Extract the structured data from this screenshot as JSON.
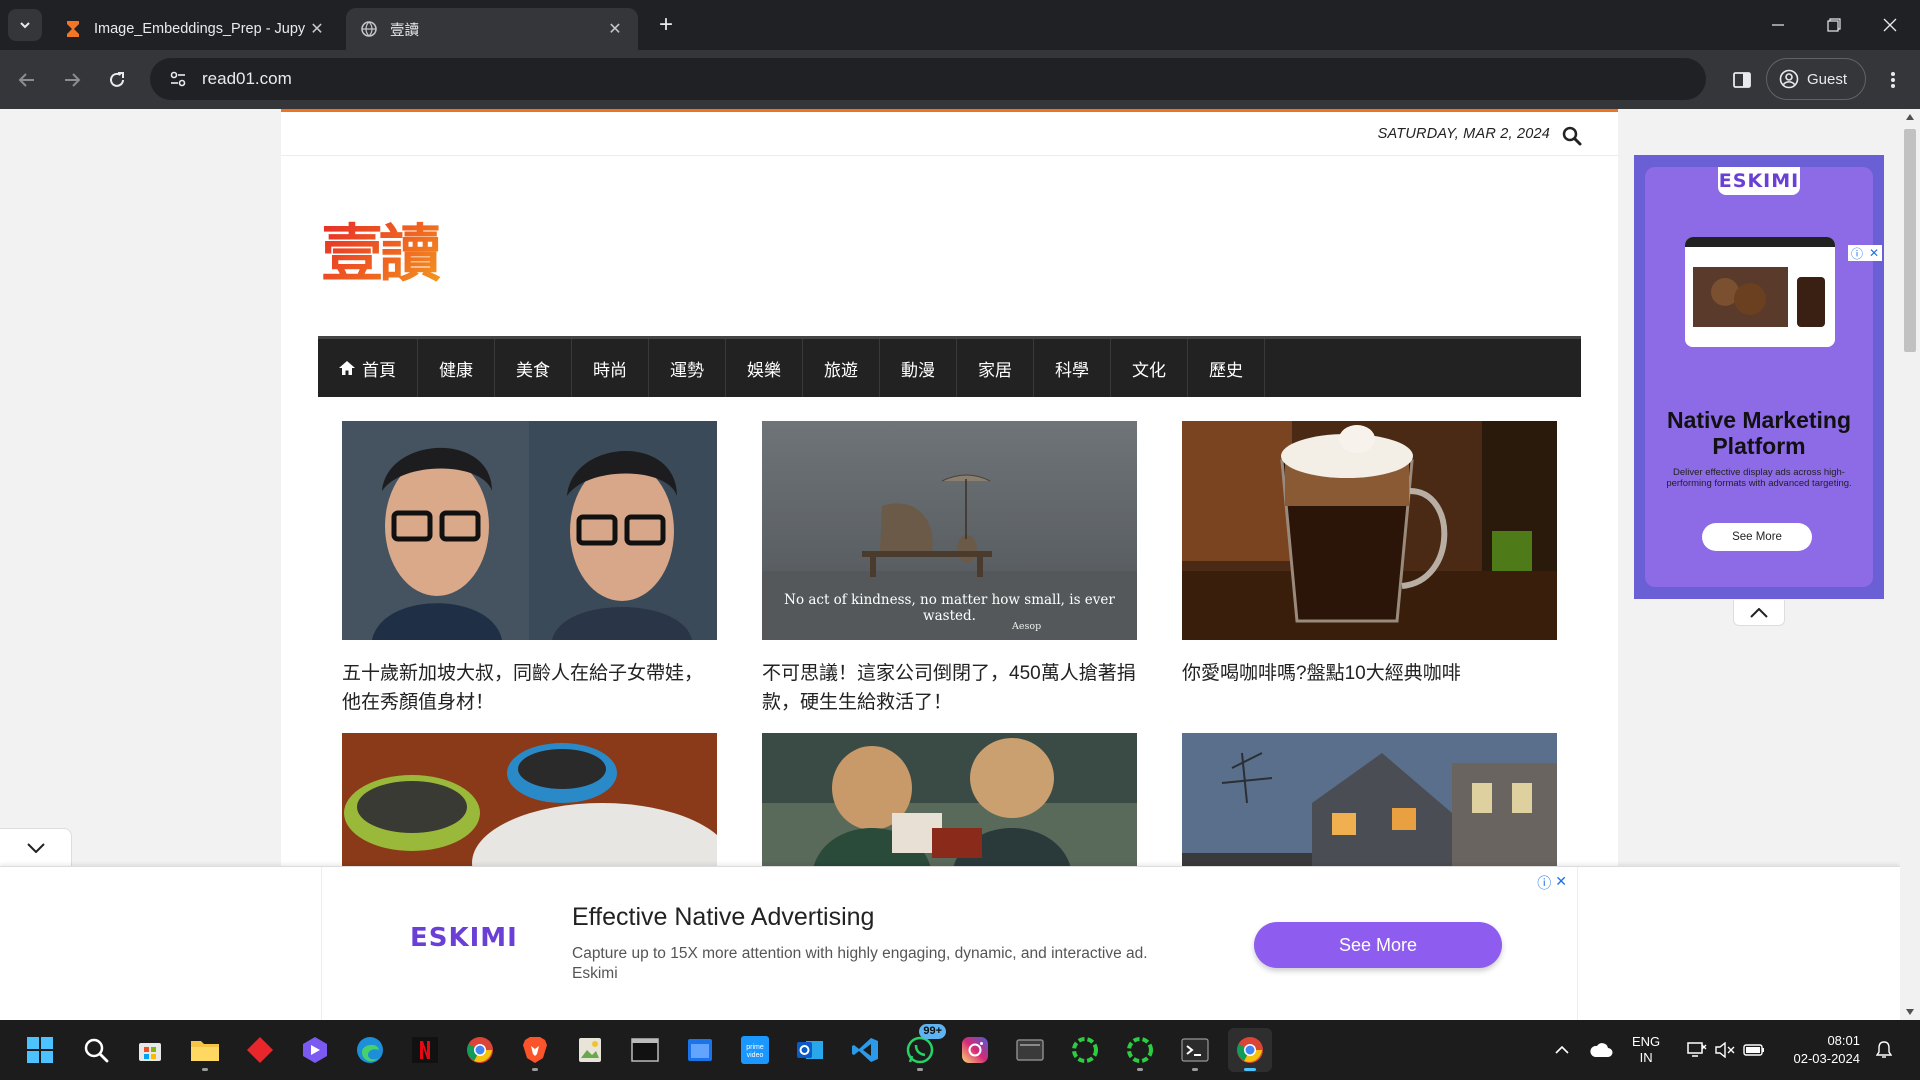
{
  "browser": {
    "tabs": [
      {
        "title": "Image_Embeddings_Prep - Jupy",
        "active": false,
        "icon": "hourglass-icon"
      },
      {
        "title": "壹讀",
        "active": true,
        "icon": "globe-icon"
      }
    ],
    "url": "read01.com",
    "profile_label": "Guest"
  },
  "site": {
    "date": "SATURDAY, MAR 2, 2024",
    "logo_text": "壹讀",
    "accent_color": "#f07322",
    "nav": [
      "首頁",
      "健康",
      "美食",
      "時尚",
      "運勢",
      "娛樂",
      "旅遊",
      "動漫",
      "家居",
      "科學",
      "文化",
      "歷史"
    ],
    "articles": [
      {
        "title": "五十歲新加坡大叔，同齡人在給子女帶娃，他在秀顏值身材！"
      },
      {
        "title": "不可思議！這家公司倒閉了，450萬人搶著捐款，硬生生給救活了！",
        "image_caption": "No act of kindness, no matter how small, is ever wasted.",
        "image_credit": "Aesop"
      },
      {
        "title": "你愛喝咖啡嗎?盤點10大經典咖啡"
      },
      {
        "title": ""
      },
      {
        "title": ""
      },
      {
        "title": ""
      }
    ]
  },
  "side_ad": {
    "brand": "ESKIMI",
    "headline": "Native Marketing Platform",
    "subtext": "Deliver effective display ads across high-performing formats with advanced targeting.",
    "button": "See More",
    "color": "#8d6ae6"
  },
  "bottom_ad": {
    "brand": "ESKIMI",
    "title": "Effective Native Advertising",
    "description": "Capture up to 15X more attention with highly engaging, dynamic, and interactive ad. Eskimi",
    "button": "See More",
    "button_color": "#8e5df0"
  },
  "taskbar": {
    "apps": [
      "windows-start",
      "search",
      "store",
      "file-explorer",
      "app-red",
      "app-purple",
      "edge",
      "netflix",
      "chrome",
      "brave",
      "notepad-image",
      "terminal-dark",
      "app-blue",
      "prime-video",
      "outlook",
      "vscode",
      "whatsapp",
      "instagram",
      "app-gray",
      "app-green-ring",
      "app-green-ring-2",
      "terminal",
      "chrome-active"
    ],
    "whatsapp_badge": "99+",
    "lang_line1": "ENG",
    "lang_line2": "IN",
    "time": "08:01",
    "date": "02-03-2024"
  }
}
